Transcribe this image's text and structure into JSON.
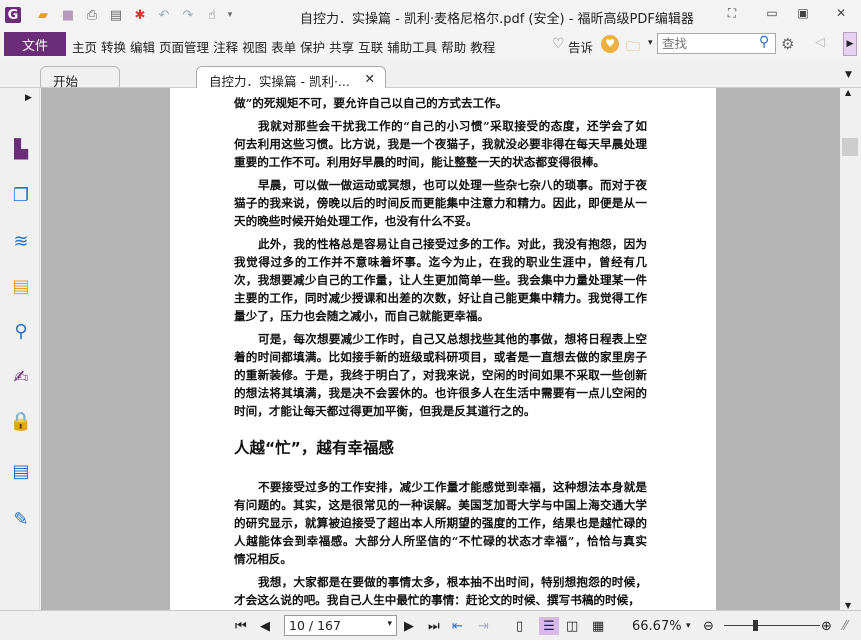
{
  "window": {
    "title": "自控力．实操篇 - 凯利·麦格尼格尔.pdf (安全) - 福昕高级PDF编辑器",
    "accent": "#6b2c7a"
  },
  "quick_access": [
    "app-logo",
    "open-icon",
    "save-icon",
    "print-icon",
    "properties-icon",
    "new-icon",
    "undo-icon",
    "redo-icon",
    "hand-tool-icon"
  ],
  "menu": {
    "file": "文件",
    "items": [
      "主页",
      "转换",
      "编辑",
      "页面管理",
      "注释",
      "视图",
      "表单",
      "保护",
      "共享",
      "互联",
      "辅助工具",
      "帮助",
      "教程"
    ],
    "tell_me": "告诉",
    "search_placeholder": "查找"
  },
  "tabs": [
    {
      "label": "开始",
      "active": false
    },
    {
      "label": "自控力．实操篇 - 凯利·...",
      "active": true,
      "close": "✕"
    }
  ],
  "document": {
    "paragraphs": [
      {
        "lines": [
          "做”的死规矩不可，要允许自己以自己的方式去工作。"
        ],
        "indent": false
      },
      {
        "lines": [
          "我就对那些会干扰我工作的“自己的小习惯”采取接受的态度，还学会了如",
          "何去利用这些习惯。比方说，我是一个夜猫子，我就没必要非得在每天早晨处理",
          "重要的工作不可。利用好早晨的时间，能让整整一天的状态都变得很棒。"
        ],
        "indent": true
      },
      {
        "lines": [
          "早晨，可以做一做运动或冥想，也可以处理一些杂七杂八的琐事。而对于夜",
          "猫子的我来说，傍晚以后的时间反而更能集中注意力和精力。因此，即便是从一",
          "天的晚些时候开始处理工作，也没有什么不妥。"
        ],
        "indent": true
      },
      {
        "lines": [
          "此外，我的性格总是容易让自己接受过多的工作。对此，我没有抱怨，因为",
          "我觉得过多的工作并不意味着坏事。迄今为止，在我的职业生涯中，曾经有几",
          "次，我想要减少自己的工作量，让人生更加简单一些。我会集中力量处理某一件",
          "主要的工作，同时减少授课和出差的次数，好让自己能更集中精力。我觉得工作",
          "量少了，压力也会随之减小，而自己就能更幸福。"
        ],
        "indent": true
      },
      {
        "lines": [
          "可是，每次想要减少工作时，自己又总想找些其他的事做，想将日程表上空",
          "着的时间都填满。比如接手新的班级或科研项目，或者是一直想去做的家里房子",
          "的重新装修。于是，我终于明白了，对我来说，空闲的时间如果不采取一些创新",
          "的想法将其填满，我是决不会罢休的。也许很多人在生活中需要有一点儿空闲的",
          "时间，才能让每天都过得更加平衡，但我是反其道行之的。"
        ],
        "indent": true
      }
    ],
    "heading": "人越“忙”，越有幸福感",
    "paragraphs2": [
      {
        "lines": [
          "不要接受过多的工作安排，减少工作量才能感觉到幸福，这种想法本身就是",
          "有问题的。其实，这是很常见的一种误解。美国芝加哥大学与中国上海交通大学",
          "的研究显示，就算被迫接受了超出本人所期望的强度的工作，结果也是越忙碌的",
          "人越能体会到幸福感。大部分人所坚信的“不忙碌的状态才幸福”，恰恰与真实",
          "情况相反。"
        ],
        "indent": true
      },
      {
        "lines": [
          "我想，大家都是在要做的事情太多，根本抽不出时间，特别想抱怨的时候，",
          "才会这么说的吧。我自己人生中最忙的事情：赶论文的时候、撰写书稿的时候，"
        ],
        "indent": true
      }
    ]
  },
  "status": {
    "page": "10 / 167",
    "zoom": "66.67%",
    "zoom_level_percent": 66.67,
    "active_view": "continuous"
  }
}
